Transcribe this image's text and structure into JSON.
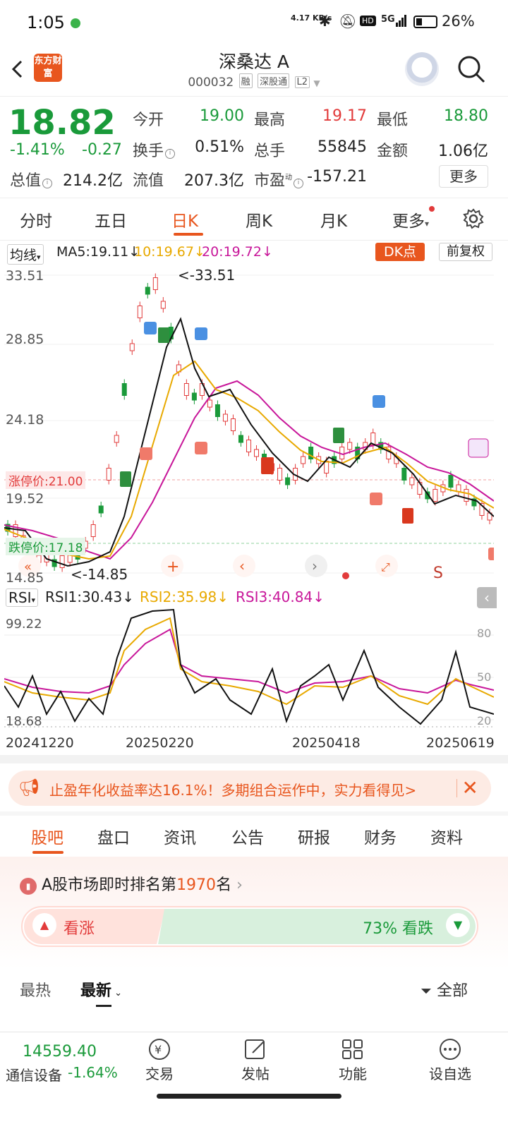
{
  "status_bar": {
    "time": "1:05",
    "net_speed": "4.17 KB/s",
    "battery": "26%",
    "signal": "5G"
  },
  "header": {
    "logo": "东方财富",
    "stock_name": "深桑达 A",
    "stock_code": "000032",
    "tags": [
      "融",
      "深股通",
      "L2"
    ]
  },
  "quote": {
    "price": "18.82",
    "change_pct": "-1.41%",
    "change": "-0.27",
    "fields": [
      {
        "label": "今开",
        "value": "19.00",
        "color": "green"
      },
      {
        "label": "最高",
        "value": "19.17",
        "color": "red"
      },
      {
        "label": "最低",
        "value": "18.80",
        "color": "green"
      },
      {
        "label": "换手",
        "value": "0.51%",
        "color": "dark"
      },
      {
        "label": "总手",
        "value": "55845",
        "color": "dark"
      },
      {
        "label": "金额",
        "value": "1.06亿",
        "color": "dark"
      },
      {
        "label": "总值",
        "value": "214.2亿",
        "color": "dark"
      },
      {
        "label": "流值",
        "value": "207.3亿",
        "color": "dark"
      },
      {
        "label": "市盈",
        "value": "-157.21",
        "color": "dark"
      }
    ],
    "pe_superscript": "动",
    "more_label": "更多"
  },
  "period_tabs": [
    "分时",
    "五日",
    "日K",
    "周K",
    "月K",
    "更多"
  ],
  "active_period": "日K",
  "indicators": {
    "main": "均线",
    "ma5": "MA5:19.11↓",
    "ma10": "10:19.67↓",
    "ma20": "20:19.72↓",
    "dk": "DK点",
    "fq": "前复权"
  },
  "kchart": {
    "y_labels": [
      "33.51",
      "28.85",
      "24.18",
      "19.52",
      "14.85"
    ],
    "high_note": "<-33.51",
    "low_note": "<-14.85",
    "limit_up": "涨停价:21.00",
    "limit_down": "跌停价:17.18",
    "signal_s": "S"
  },
  "rsi": {
    "label": "RSI",
    "rsi1": "RSI1:30.43↓",
    "rsi2": "RSI2:35.98↓",
    "rsi3": "RSI3:40.84↓",
    "y_top": "99.22",
    "y_bottom": "18.68",
    "levels": [
      "80",
      "50",
      "20"
    ]
  },
  "x_labels": [
    "20241220",
    "20250220",
    "20250418",
    "20250619"
  ],
  "chart_data": {
    "type": "line",
    "title": "",
    "x": [
      "20241220",
      "20250220",
      "20250418",
      "20250619"
    ],
    "ylim": [
      14.85,
      33.51
    ],
    "series": [
      {
        "name": "MA5",
        "values": [
          18.5,
          28.5,
          22.0,
          19.11
        ]
      },
      {
        "name": "10",
        "values": [
          18.7,
          26.0,
          23.0,
          19.67
        ]
      },
      {
        "name": "20",
        "values": [
          18.9,
          22.0,
          24.0,
          19.72
        ]
      }
    ]
  },
  "ad": {
    "text": "止盈年化收益率达16.1%！多期组合运作中，实力看得见>"
  },
  "main_tabs": [
    "股吧",
    "盘口",
    "资讯",
    "公告",
    "研报",
    "财务",
    "资料"
  ],
  "ranking": {
    "prefix": "A股市场即时排名第",
    "rank": "1970",
    "suffix": "名"
  },
  "vote": {
    "up": "看涨",
    "down_pct": "73%",
    "down": "看跌"
  },
  "sort": {
    "hot": "最热",
    "new": "最新",
    "filter": "全部"
  },
  "bottom_nav": {
    "index_value": "14559.40",
    "index_name": "通信设备",
    "index_change": "-1.64%",
    "items": [
      "交易",
      "发帖",
      "功能",
      "设自选"
    ]
  }
}
